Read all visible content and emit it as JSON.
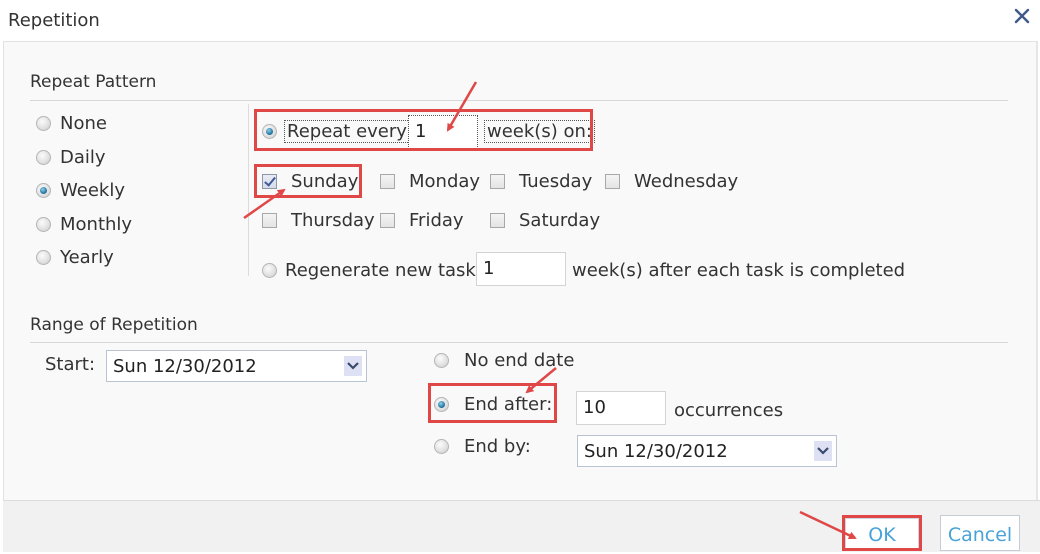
{
  "window": {
    "title": "Repetition",
    "close_icon": "close-icon"
  },
  "repeat_pattern": {
    "title": "Repeat Pattern",
    "frequency_options": [
      {
        "label": "None",
        "selected": false
      },
      {
        "label": "Daily",
        "selected": false
      },
      {
        "label": "Weekly",
        "selected": true
      },
      {
        "label": "Monthly",
        "selected": false
      },
      {
        "label": "Yearly",
        "selected": false
      }
    ],
    "repeat_every": {
      "selected": true,
      "label_before": "Repeat every",
      "value": "1",
      "label_after": "week(s) on:"
    },
    "days": [
      {
        "label": "Sunday",
        "checked": true
      },
      {
        "label": "Monday",
        "checked": false
      },
      {
        "label": "Tuesday",
        "checked": false
      },
      {
        "label": "Wednesday",
        "checked": false
      },
      {
        "label": "Thursday",
        "checked": false
      },
      {
        "label": "Friday",
        "checked": false
      },
      {
        "label": "Saturday",
        "checked": false
      }
    ],
    "regenerate": {
      "selected": false,
      "label_before": "Regenerate new task",
      "value": "1",
      "label_after": "week(s) after each task is completed"
    }
  },
  "range": {
    "title": "Range of Repetition",
    "start_label": "Start:",
    "start_value": "Sun 12/30/2012",
    "end_options": {
      "no_end_date": {
        "label": "No end date",
        "selected": false
      },
      "end_after": {
        "label": "End after:",
        "selected": true,
        "value": "10",
        "suffix": "occurrences"
      },
      "end_by": {
        "label": "End by:",
        "selected": false,
        "value": "Sun 12/30/2012"
      }
    }
  },
  "buttons": {
    "ok": "OK",
    "cancel": "Cancel"
  },
  "annotation_color": "#e04848"
}
